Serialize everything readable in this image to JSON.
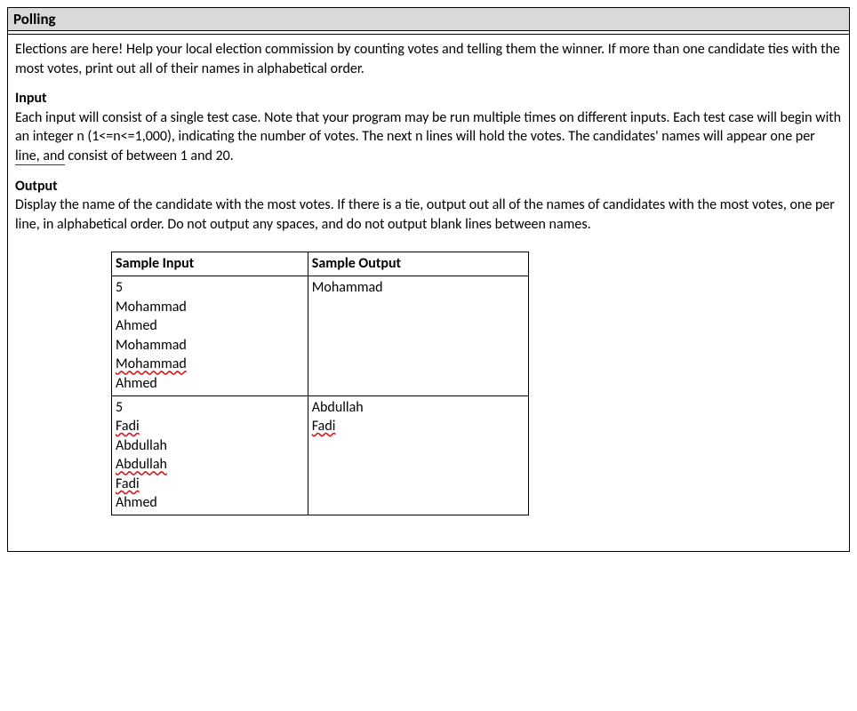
{
  "title": "Polling",
  "intro": "Elections are here! Help your local election commission by counting votes and telling them the winner. If more than one candidate ties with the most votes, print out all of their names in alphabetical order.",
  "input": {
    "heading": "Input",
    "text_pre": "Each input will consist of a single test case. Note that your program may be run multiple times on different inputs. Each test case will begin with an integer n (1<=n<=1,000), indicating the number of votes. The next n lines will hold the votes. The candidates' names will appear one per ",
    "underlined": "line, and",
    "text_post": " consist of between 1 and 20."
  },
  "output": {
    "heading": "Output",
    "text": "Display the name of the candidate with the most votes. If there is a tie, output out all of the names of candidates with the most votes, one per line, in alphabetical order. Do not output any spaces, and do not output blank lines between names."
  },
  "table": {
    "header_in": "Sample Input",
    "header_out": "Sample Output",
    "rows": [
      {
        "input": [
          "5",
          "Mohammad",
          "Ahmed",
          "Mohammad",
          "Mohammad",
          "Ahmed"
        ],
        "input_squiggle_idx": [
          4
        ],
        "output": [
          "Mohammad"
        ],
        "output_squiggle_idx": []
      },
      {
        "input": [
          "5",
          "Fadi",
          "Abdullah",
          "Abdullah",
          "Fadi",
          "Ahmed"
        ],
        "input_squiggle_idx": [
          1,
          3,
          4
        ],
        "output": [
          "Abdullah",
          "Fadi"
        ],
        "output_squiggle_idx": [
          1
        ]
      }
    ]
  }
}
